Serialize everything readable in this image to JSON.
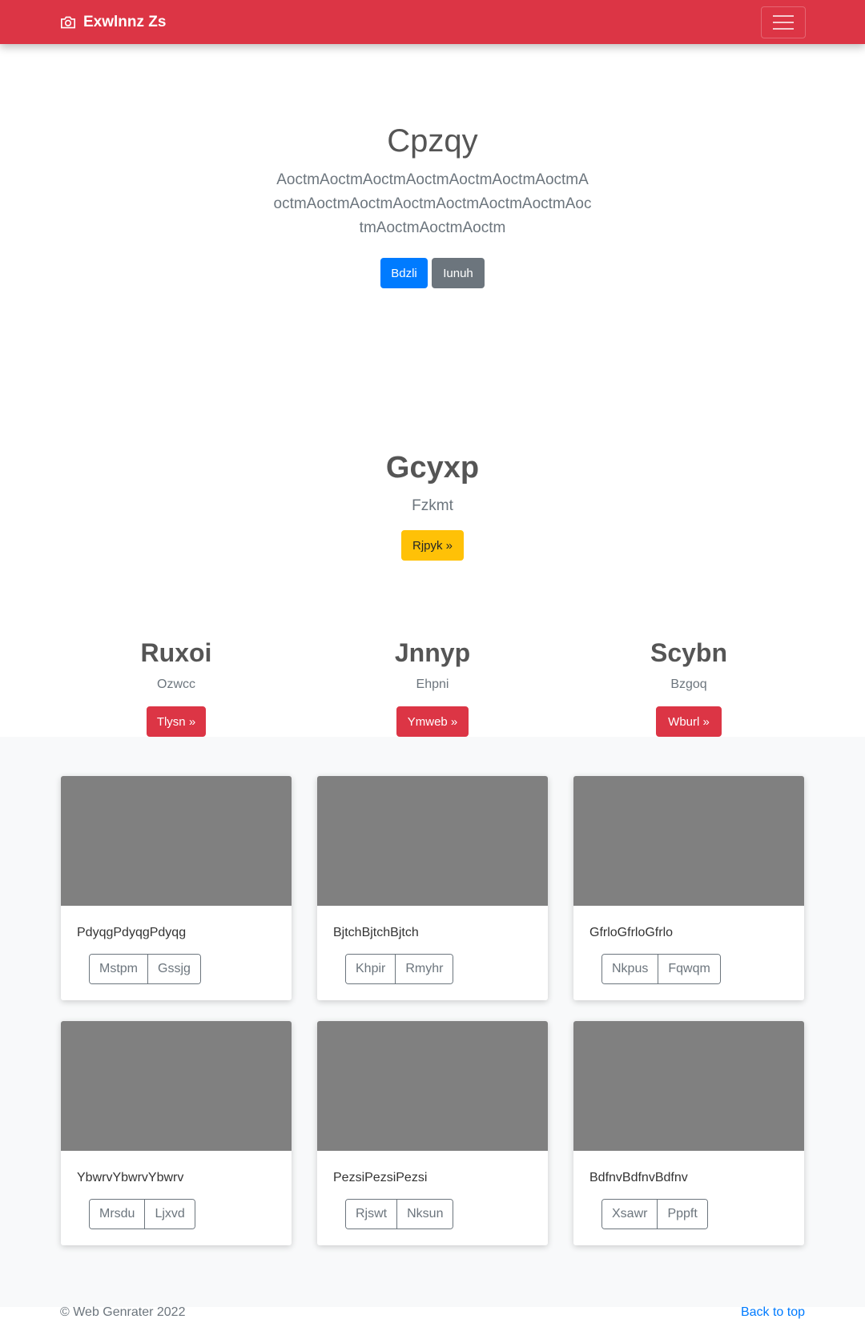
{
  "navbar": {
    "brand": "Exwlnnz Zs",
    "brand_icon": "camera-icon",
    "toggler_icon": "hamburger-menu-icon",
    "color": "#dc3545"
  },
  "hero": {
    "title": "Cpzqy",
    "lead": "AoctmAoctmAoctmAoctmAoctmAoctmAoctmAoctmAoctmAoctmAoctmAoctmAoctmAoctmAoctmAoctmAoctmAoctm",
    "primary_button": "Bdzli",
    "secondary_button": "Iunuh"
  },
  "feature": {
    "title": "Gcyxp",
    "subtitle": "Fzkmt",
    "button": "Rjpyk »"
  },
  "columns": [
    {
      "title": "Ruxoi",
      "text": "Ozwcc",
      "button": "Tlysn »"
    },
    {
      "title": "Jnnyp",
      "text": "Ehpni",
      "button": "Ymweb »"
    },
    {
      "title": "Scybn",
      "text": "Bzgoq",
      "button": "Wburl »"
    }
  ],
  "cards": [
    {
      "text": "PdyqgPdyqgPdyqg",
      "btn1": "Mstpm",
      "btn2": "Gssjg"
    },
    {
      "text": "BjtchBjtchBjtch",
      "btn1": "Khpir",
      "btn2": "Rmyhr"
    },
    {
      "text": "GfrloGfrloGfrlo",
      "btn1": "Nkpus",
      "btn2": "Fqwqm"
    },
    {
      "text": "YbwrvYbwrvYbwrv",
      "btn1": "Mrsdu",
      "btn2": "Ljxvd"
    },
    {
      "text": "PezsiPezsiPezsi",
      "btn1": "Rjswt",
      "btn2": "Nksun"
    },
    {
      "text": "BdfnvBdfnvBdfnv",
      "btn1": "Xsawr",
      "btn2": "Pppft"
    }
  ],
  "footer": {
    "copyright": "© Web Genrater 2022",
    "back_to_top": "Back to top"
  }
}
